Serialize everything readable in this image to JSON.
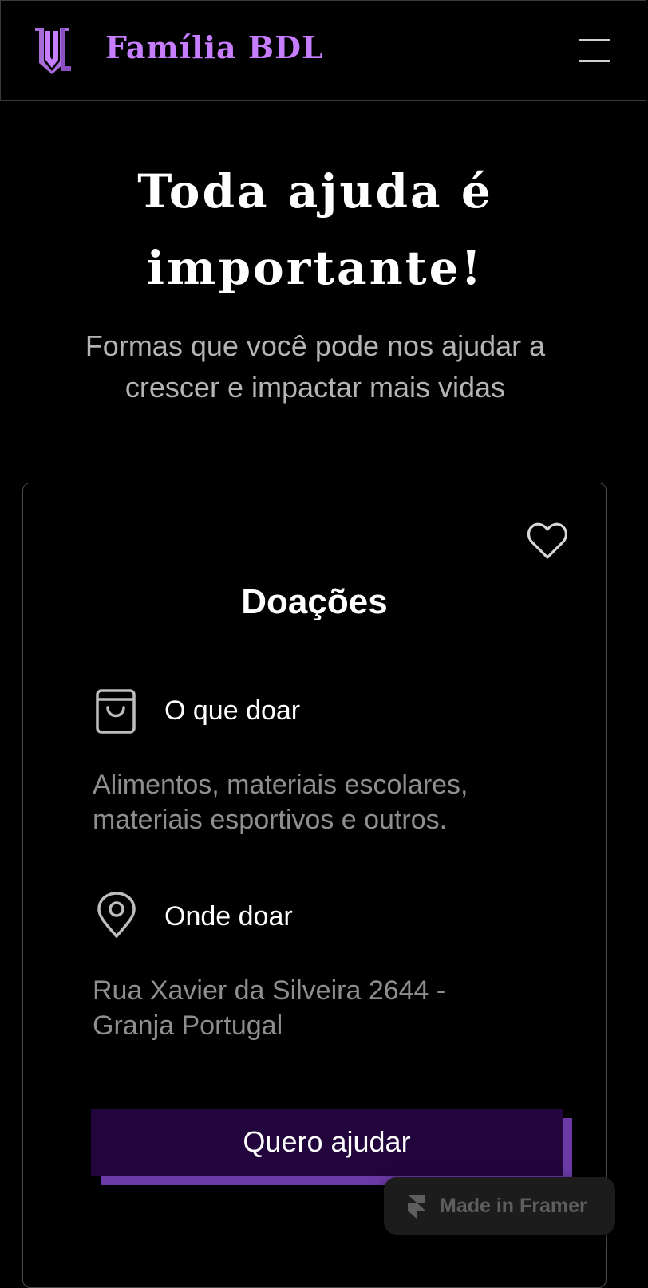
{
  "header": {
    "brand_name": "Família BDL",
    "logo_icon": "bdl-shield-logo",
    "menu_icon": "hamburger-menu-icon",
    "brand_color": "#c77dff"
  },
  "hero": {
    "title_line1": "Toda ajuda é",
    "title_line2": "importante!",
    "subtitle_line1": "Formas que você pode nos ajudar a",
    "subtitle_line2": "crescer e impactar mais vidas"
  },
  "donation_card": {
    "favorite_icon": "heart-icon",
    "title": "Doações",
    "what_to_donate": {
      "icon": "shopping-bag-icon",
      "label": "O que doar",
      "text_line1": "Alimentos, materiais escolares,",
      "text_line2": "materiais esportivos e outros."
    },
    "where_to_donate": {
      "icon": "map-pin-icon",
      "label": "Onde doar",
      "text_line1": "Rua Xavier da Silveira 2644 -",
      "text_line2": "Granja Portugal"
    },
    "cta_label": "Quero ajudar",
    "cta_color": "#22053d",
    "cta_shadow_color": "#6b3aa6"
  },
  "framer_badge": {
    "icon": "framer-icon",
    "label": "Made in Framer"
  }
}
